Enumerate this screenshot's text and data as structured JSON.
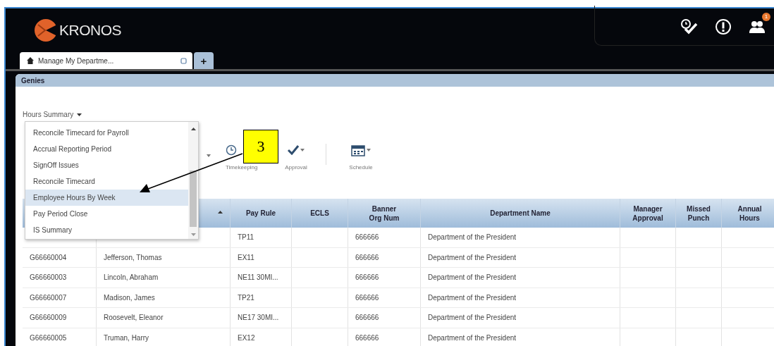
{
  "header": {
    "logo": "KRONOS",
    "notification_badge": "1"
  },
  "tabs": [
    {
      "label": "Manage My Departme...",
      "selected": true
    },
    {
      "label": "+",
      "selected": false
    }
  ],
  "genies_bar": {
    "title": "Genies"
  },
  "genie_select": {
    "label": "Hours Summary",
    "options": [
      {
        "label": "Reconcile Timecard for Payroll",
        "selected": false
      },
      {
        "label": "Accrual Reporting Period",
        "selected": false
      },
      {
        "label": "SignOff Issues",
        "selected": false
      },
      {
        "label": "Reconcile Timecard",
        "selected": false
      },
      {
        "label": "Employee Hours By Week",
        "selected": true
      },
      {
        "label": "Pay Period Close",
        "selected": false
      },
      {
        "label": "IS Summary",
        "selected": false
      }
    ]
  },
  "toolbar": [
    {
      "kind": "hidden",
      "dropdown": true
    },
    {
      "kind": "clock",
      "label": "Timekeeping"
    },
    {
      "kind": "check",
      "label": "Approval",
      "dropdown": true
    },
    {
      "kind": "calendar",
      "label": "Schedule",
      "dropdown": true
    }
  ],
  "callout": {
    "number": "3"
  },
  "table": {
    "columns": [
      {},
      {
        "sorted": true
      },
      {
        "lines": [
          "Pay Rule"
        ],
        "sorted": false
      },
      {
        "lines": [
          "ECLS"
        ],
        "sorted": false
      },
      {
        "lines": [
          "Banner",
          "Org Num"
        ],
        "sorted": false
      },
      {
        "lines": [
          "Department Name"
        ],
        "sorted": false
      },
      {
        "lines": [
          "Manager",
          "Approval"
        ],
        "sorted": false
      },
      {
        "lines": [
          "Missed",
          "Punch"
        ],
        "sorted": false
      },
      {
        "lines": [
          "Annual",
          "Hours"
        ],
        "sorted": false
      }
    ],
    "rows": [
      {
        "pay_rule": "TP11",
        "org_num": "666666",
        "department": "Department of the President"
      },
      {
        "id": "G66660004",
        "name": "Jefferson, Thomas",
        "pay_rule": "EX11",
        "org_num": "666666",
        "department": "Department of the President"
      },
      {
        "id": "G66660003",
        "name": "Lincoln, Abraham",
        "pay_rule": "NE11 30MI...",
        "org_num": "666666",
        "department": "Department of the President"
      },
      {
        "id": "G66660007",
        "name": "Madison, James",
        "pay_rule": "TP21",
        "org_num": "666666",
        "department": "Department of the President"
      },
      {
        "id": "G66660009",
        "name": "Roosevelt, Eleanor",
        "pay_rule": "NE17 30MI...",
        "org_num": "666666",
        "department": "Department of the President"
      },
      {
        "id": "G66660005",
        "name": "Truman, Harry",
        "pay_rule": "EX12",
        "org_num": "666666",
        "department": "Department of the President"
      }
    ]
  }
}
